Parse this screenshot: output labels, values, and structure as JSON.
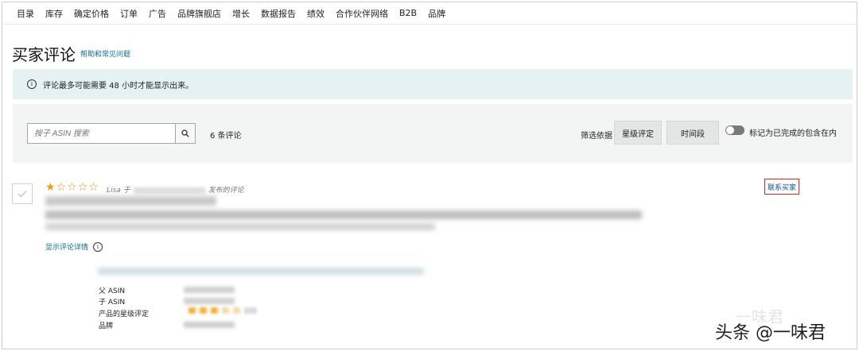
{
  "nav": {
    "items": [
      "目录",
      "库存",
      "确定价格",
      "订单",
      "广告",
      "品牌旗舰店",
      "增长",
      "数据报告",
      "绩效",
      "合作伙伴网络",
      "B2B",
      "品牌"
    ]
  },
  "page": {
    "title": "买家评论",
    "help_link": "帮助和常见问题"
  },
  "banner": {
    "icon": "i",
    "text": "评论最多可能需要 48 小时才能显示出来。"
  },
  "filters": {
    "search_placeholder": "按子 ASIN 搜索",
    "search_icon": "search-icon",
    "review_count": "6 条评论",
    "filter_by_label": "筛选依据",
    "rating_button": "星级评定",
    "period_button": "时间段",
    "toggle_label": "标记为已完成的包含在内",
    "toggle_on": false
  },
  "review": {
    "rating": 1,
    "max_rating": 5,
    "stars": [
      "★",
      "☆",
      "☆",
      "☆",
      "☆"
    ],
    "reviewer_name": "Lisa 于",
    "reviewer_suffix": "发布的评论",
    "contact_button": "联系买家",
    "show_details": "显示评论详情",
    "meta_labels": {
      "parent_asin": "父 ASIN",
      "child_asin": "子 ASIN",
      "product_rating": "产品的星级评定",
      "brand": "品牌"
    }
  },
  "watermark": {
    "logo_text": "一味君",
    "text": "头条 @一味君"
  },
  "colors": {
    "banner_bg": "#e6f1f2",
    "link": "#0b6f8e",
    "star": "#e99c15",
    "contact_border": "#d9251d"
  }
}
